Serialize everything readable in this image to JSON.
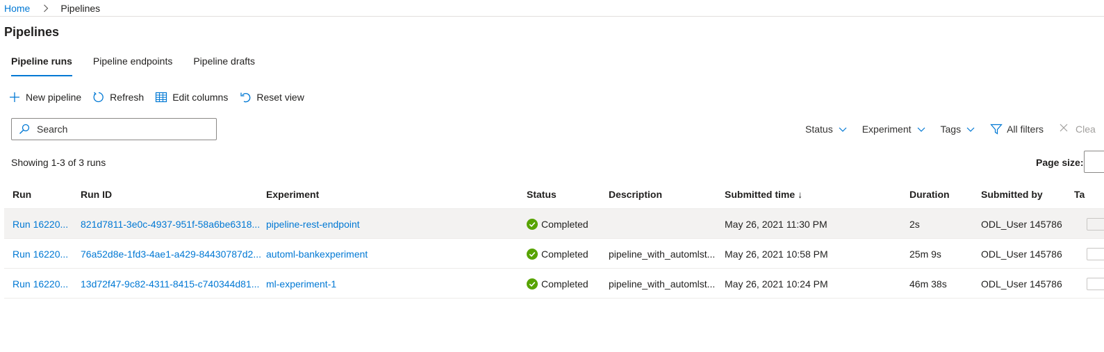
{
  "breadcrumb": {
    "home": "Home",
    "current": "Pipelines"
  },
  "page_title": "Pipelines",
  "tabs": [
    {
      "label": "Pipeline runs",
      "active": true
    },
    {
      "label": "Pipeline endpoints",
      "active": false
    },
    {
      "label": "Pipeline drafts",
      "active": false
    }
  ],
  "toolbar": {
    "new_pipeline": "New pipeline",
    "refresh": "Refresh",
    "edit_columns": "Edit columns",
    "reset_view": "Reset view"
  },
  "search": {
    "placeholder": "Search"
  },
  "filters": {
    "status": "Status",
    "experiment": "Experiment",
    "tags": "Tags",
    "all_filters": "All filters",
    "clear": "Clea"
  },
  "showing": "Showing 1-3 of 3 runs",
  "page_size_label": "Page size:",
  "table": {
    "headers": {
      "run": "Run",
      "run_id": "Run ID",
      "experiment": "Experiment",
      "status": "Status",
      "description": "Description",
      "submitted_time": "Submitted time",
      "sort_arrow": "↓",
      "duration": "Duration",
      "submitted_by": "Submitted by",
      "tags": "Ta"
    },
    "rows": [
      {
        "run": "Run 16220...",
        "run_id": "821d7811-3e0c-4937-951f-58a6be6318...",
        "experiment": "pipeline-rest-endpoint",
        "status": "Completed",
        "description": "",
        "submitted_time": "May 26, 2021 11:30 PM",
        "duration": "2s",
        "submitted_by": "ODL_User 145786"
      },
      {
        "run": "Run 16220...",
        "run_id": "76a52d8e-1fd3-4ae1-a429-84430787d2...",
        "experiment": "automl-bankexperiment",
        "status": "Completed",
        "description": "pipeline_with_automlst...",
        "submitted_time": "May 26, 2021 10:58 PM",
        "duration": "25m 9s",
        "submitted_by": "ODL_User 145786"
      },
      {
        "run": "Run 16220...",
        "run_id": "13d72f47-9c82-4311-8415-c740344d81...",
        "experiment": "ml-experiment-1",
        "status": "Completed",
        "description": "pipeline_with_automlst...",
        "submitted_time": "May 26, 2021 10:24 PM",
        "duration": "46m 38s",
        "submitted_by": "ODL_User 145786"
      }
    ]
  },
  "colors": {
    "accent": "#0078d4",
    "success": "#57a300"
  }
}
